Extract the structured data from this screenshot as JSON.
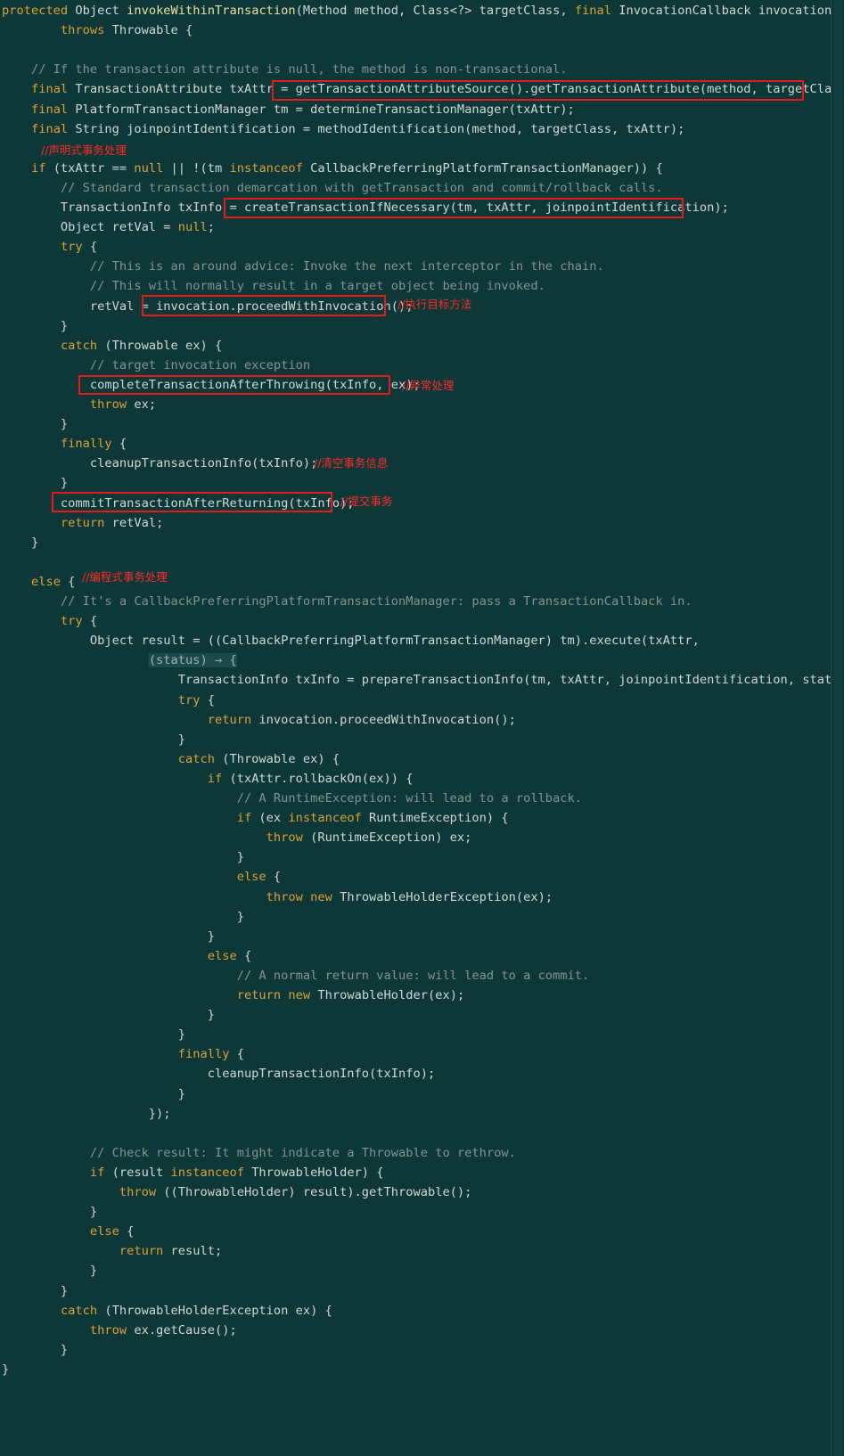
{
  "code_lines": [
    "protected Object invokeWithinTransaction(Method method, Class<?> targetClass, final InvocationCallback invocation)",
    "        throws Throwable {",
    "",
    "    // If the transaction attribute is null, the method is non-transactional.",
    "    final TransactionAttribute txAttr = getTransactionAttributeSource().getTransactionAttribute(method, targetClass);",
    "    final PlatformTransactionManager tm = determineTransactionManager(txAttr);",
    "    final String joinpointIdentification = methodIdentification(method, targetClass, txAttr);",
    "",
    "    if (txAttr == null || !(tm instanceof CallbackPreferringPlatformTransactionManager)) {",
    "        // Standard transaction demarcation with getTransaction and commit/rollback calls.",
    "        TransactionInfo txInfo = createTransactionIfNecessary(tm, txAttr, joinpointIdentification);",
    "        Object retVal = null;",
    "        try {",
    "            // This is an around advice: Invoke the next interceptor in the chain.",
    "            // This will normally result in a target object being invoked.",
    "            retVal = invocation.proceedWithInvocation();",
    "        }",
    "        catch (Throwable ex) {",
    "            // target invocation exception",
    "            completeTransactionAfterThrowing(txInfo, ex);",
    "            throw ex;",
    "        }",
    "        finally {",
    "            cleanupTransactionInfo(txInfo);",
    "        }",
    "        commitTransactionAfterReturning(txInfo);",
    "        return retVal;",
    "    }",
    "",
    "    else {",
    "        // It's a CallbackPreferringPlatformTransactionManager: pass a TransactionCallback in.",
    "        try {",
    "            Object result = ((CallbackPreferringPlatformTransactionManager) tm).execute(txAttr,",
    "                    (status) -> {",
    "                        TransactionInfo txInfo = prepareTransactionInfo(tm, txAttr, joinpointIdentification, status",
    "                        try {",
    "                            return invocation.proceedWithInvocation();",
    "                        }",
    "                        catch (Throwable ex) {",
    "                            if (txAttr.rollbackOn(ex)) {",
    "                                // A RuntimeException: will lead to a rollback.",
    "                                if (ex instanceof RuntimeException) {",
    "                                    throw (RuntimeException) ex;",
    "                                }",
    "                                else {",
    "                                    throw new ThrowableHolderException(ex);",
    "                                }",
    "                            }",
    "                            else {",
    "                                // A normal return value: will lead to a commit.",
    "                                return new ThrowableHolder(ex);",
    "                            }",
    "                        }",
    "                        finally {",
    "                            cleanupTransactionInfo(txInfo);",
    "                        }",
    "                    });",
    "",
    "            // Check result: It might indicate a Throwable to rethrow.",
    "            if (result instanceof ThrowableHolder) {",
    "                throw ((ThrowableHolder) result).getThrowable();",
    "            }",
    "            else {",
    "                return result;",
    "            }",
    "        }",
    "        catch (ThrowableHolderException ex) {",
    "            throw ex.getCause();",
    "        }",
    "}"
  ],
  "annotations": {
    "declarative": "//声明式事务处理",
    "invoke_target": "//执行目标方法",
    "exception_handling": "//异常处理",
    "clear_tx_info": "//清空事务信息",
    "commit_tx": "//提交事务",
    "programmatic": "//编程式事务处理"
  },
  "colors": {
    "background": "#0e3737",
    "keyword": "#d9a23a",
    "comment": "#84948f",
    "text": "#cfd8d4",
    "highlight_box": "#e31b1b",
    "annotation": "#ff2a2a"
  }
}
